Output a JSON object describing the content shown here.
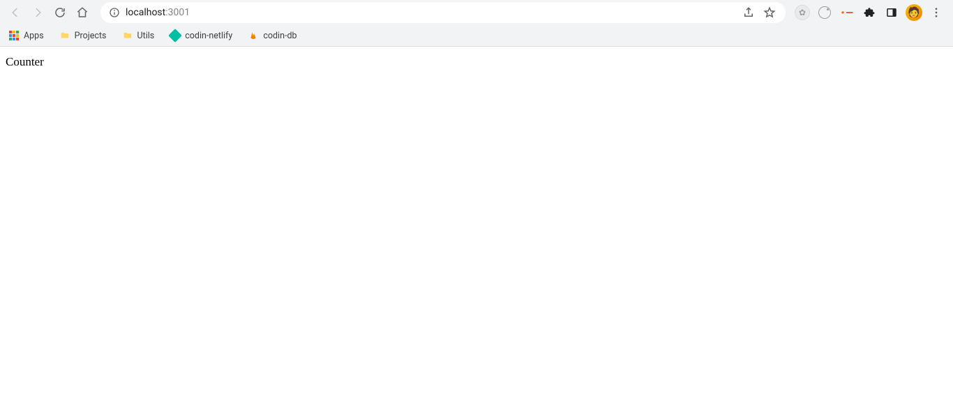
{
  "address": {
    "host": "localhost",
    "port": ":3001"
  },
  "bookmarks": {
    "apps": "Apps",
    "projects": "Projects",
    "utils": "Utils",
    "codin_netlify": "codin-netlify",
    "codin_db": "codin-db"
  },
  "page": {
    "heading": "Counter"
  }
}
